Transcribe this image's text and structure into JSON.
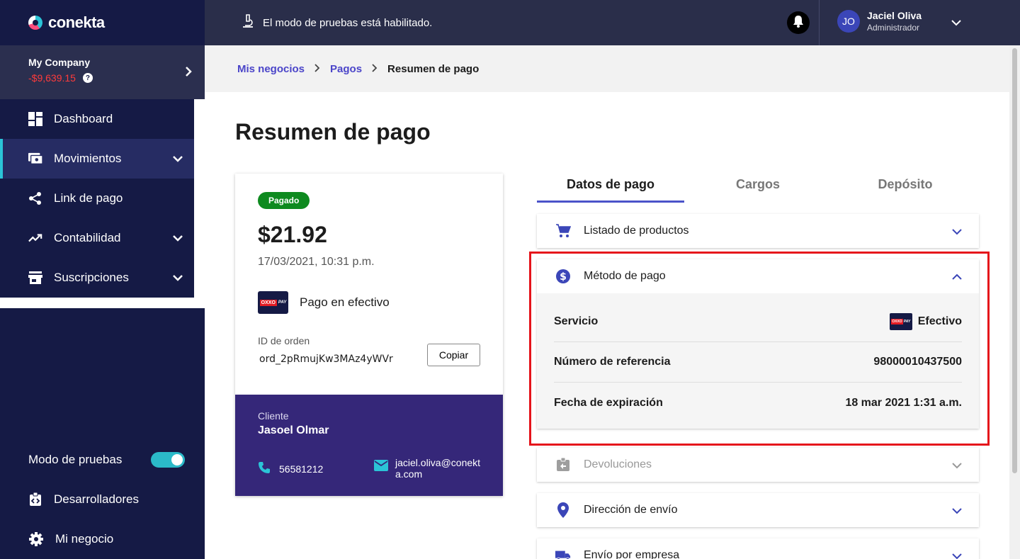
{
  "brand": {
    "name": "conekta"
  },
  "company": {
    "name": "My Company",
    "balance": "-$9,639.15",
    "help": "?"
  },
  "sidebar": {
    "items": [
      {
        "label": "Dashboard",
        "icon": "dashboard-icon"
      },
      {
        "label": "Movimientos",
        "icon": "payments-icon",
        "active": true
      },
      {
        "label": "Link de pago",
        "icon": "share-icon"
      },
      {
        "label": "Contabilidad",
        "icon": "trending-icon"
      },
      {
        "label": "Suscripciones",
        "icon": "store-icon"
      }
    ],
    "bottom": {
      "test_mode_label": "Modo de pruebas",
      "developers_label": "Desarrolladores",
      "business_label": "Mi negocio"
    }
  },
  "topbar": {
    "test_mode_message": "El modo de pruebas está habilitado.",
    "user": {
      "initials": "JO",
      "name": "Jaciel Oliva",
      "role": "Administrador"
    }
  },
  "breadcrumb": {
    "items": [
      "Mis negocios",
      "Pagos"
    ],
    "current": "Resumen de pago"
  },
  "page": {
    "title": "Resumen de pago"
  },
  "summary": {
    "status": "Pagado",
    "amount": "$21.92",
    "date": "17/03/2021, 10:31 p.m.",
    "method": "Pago en efectivo",
    "order_label": "ID de orden",
    "order_id": "ord_2pRmujKw3MAz4yWVr",
    "copy_label": "Copiar",
    "oxxo_text": "OXXO",
    "oxxo_pay": "PAY",
    "client": {
      "label": "Cliente",
      "name": "Jasoel Olmar",
      "phone": "56581212",
      "email": "jaciel.oliva@conekta.com"
    }
  },
  "tabs": [
    "Datos de pago",
    "Cargos",
    "Depósito"
  ],
  "sections": {
    "products": "Listado de productos",
    "payment_method": "Método de pago",
    "refunds": "Devoluciones",
    "shipping_address": "Dirección de envío",
    "shipping_company": "Envío por empresa"
  },
  "payment_details": {
    "service_label": "Servicio",
    "service_value": "Efectivo",
    "reference_label": "Número de referencia",
    "reference_value": "98000010437500",
    "expiration_label": "Fecha de expiración",
    "expiration_value": "18 mar 2021 1:31 a.m."
  },
  "colors": {
    "sidebar": "#151a45",
    "accent": "#4b53c9",
    "teal": "#2bc4d7",
    "client_bg": "#352779",
    "paid": "#0e8a1f",
    "highlight": "#e5141b"
  }
}
